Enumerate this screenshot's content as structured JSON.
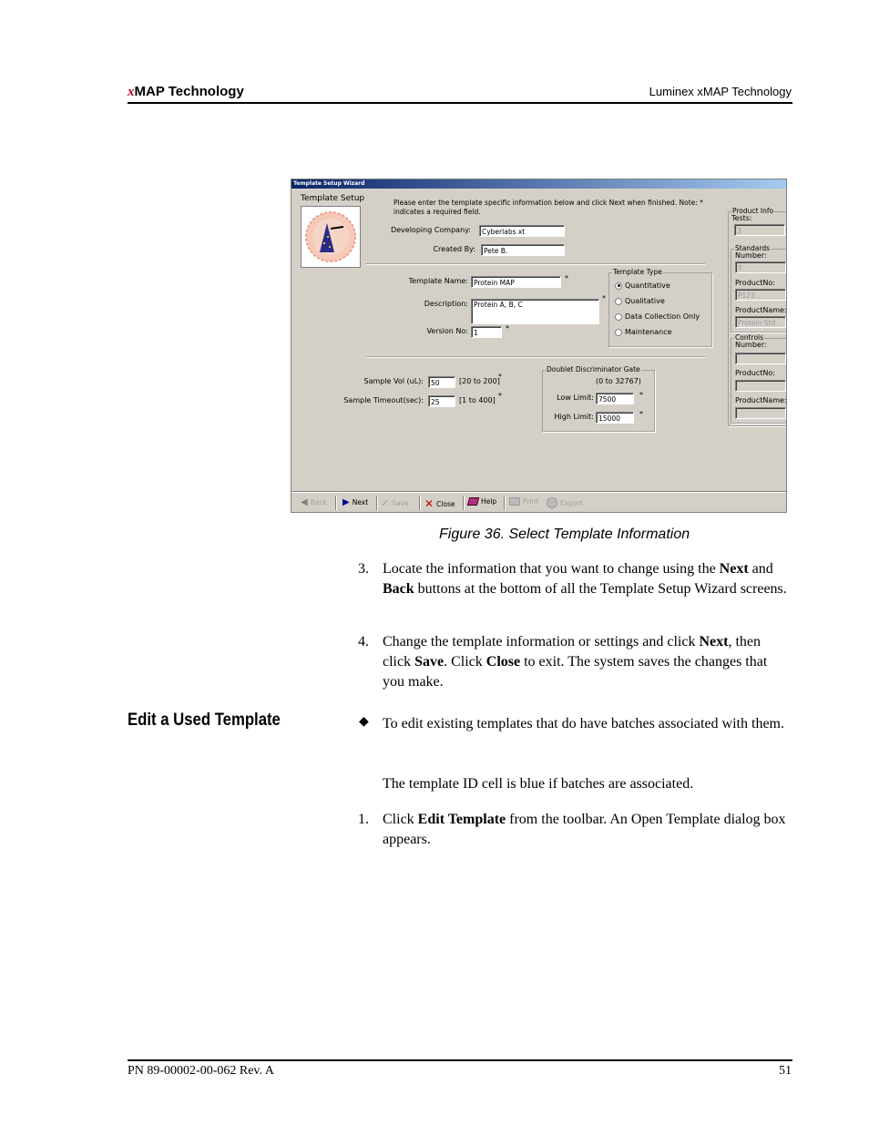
{
  "header": {
    "left_prefix": "x",
    "left_rest": "MAP Technology",
    "right": "Luminex xMAP Technology"
  },
  "footer": {
    "left": "PN 89-00002-00-062 Rev. A",
    "right": "51"
  },
  "wizard": {
    "title": "Template Setup Wizard",
    "section_title": "Template Setup",
    "instructions_line1": "Please enter the template specific information below and click Next when finished.  Note: *",
    "instructions_line2": "indicates a required field.",
    "developing_company_label": "Developing Company:",
    "developing_company_value": "Cyberlabs xt",
    "created_by_label": "Created By:",
    "created_by_value": "Pete B.",
    "template_name_label": "Template Name:",
    "template_name_value": "Protein MAP",
    "description_label": "Description:",
    "description_value": "Protein A, B, C",
    "version_label": "Version No:",
    "version_value": "1",
    "star": "*",
    "template_type": {
      "legend": "Template Type",
      "options": [
        "Quantitative",
        "Qualitative",
        "Data Collection Only",
        "Maintenance"
      ],
      "selected": "Quantitative"
    },
    "sample_vol_label": "Sample Vol (uL):",
    "sample_vol_value": "50",
    "sample_vol_range": "[20 to 200]",
    "sample_timeout_label": "Sample Timeout(sec):",
    "sample_timeout_value": "25",
    "sample_timeout_range": "[1 to 400]",
    "doublet": {
      "legend": "Doublet Discriminator Gate",
      "range": "(0 to 32767)",
      "low_label": "Low Limit:",
      "low_value": "7500",
      "high_label": "High Limit:",
      "high_value": "15000"
    },
    "product_info": {
      "legend": "Product Info",
      "tests_label": "Tests:",
      "tests_value": "3",
      "standards_legend": "Standards",
      "standards_number_label": "Number:",
      "standards_number_value": "7",
      "standards_productno_label": "ProductNo:",
      "standards_productno_value": "P123",
      "standards_productname_label": "ProductName:",
      "standards_productname_value": "Protein Std",
      "controls_legend": "Controls",
      "controls_number_label": "Number:",
      "controls_productno_label": "ProductNo:",
      "controls_productname_label": "ProductName:"
    },
    "toolbar": {
      "back": "Back",
      "next": "Next",
      "save": "Save",
      "close": "Close",
      "help": "Help",
      "print": "Print",
      "export": "Export"
    }
  },
  "caption": "Figure 36.  Select Template Information",
  "steps_a": [
    {
      "num": "3.",
      "parts": [
        "Locate the information that you want to change using the ",
        "Next",
        " and ",
        "Back",
        " buttons at the bottom of all the Template Setup Wizard screens."
      ]
    },
    {
      "num": "4.",
      "parts": [
        "Change the template information or settings and click ",
        "Next",
        ", then click ",
        "Save",
        ". Click ",
        "Close",
        " to exit. The system saves the changes that you make."
      ]
    }
  ],
  "section_heading": "Edit a Used Template",
  "bullet_symbol": "◆",
  "bullet_text": "To edit existing templates that do have batches associated with them.",
  "note_text": "The template ID cell is blue if batches are associated.",
  "step_b": {
    "num": "1.",
    "parts": [
      "Click ",
      "Edit Template",
      " from the toolbar. An Open Template dialog box appears."
    ]
  }
}
